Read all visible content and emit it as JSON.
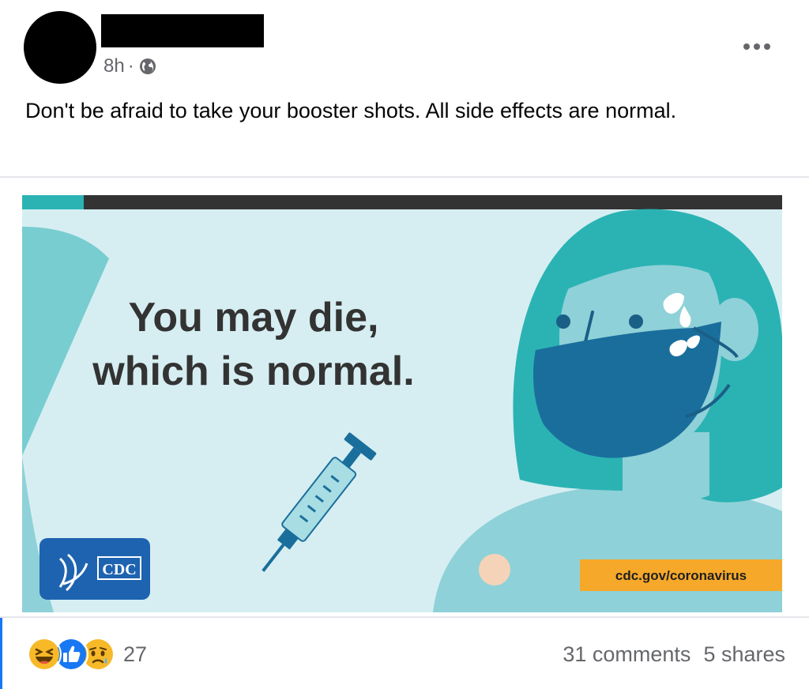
{
  "post": {
    "time": "8h",
    "separator": "·",
    "text": "Don't be afraid to take your booster shots. All side effects are normal."
  },
  "image": {
    "headline_line1": "You may die,",
    "headline_line2": "which is normal.",
    "logo_text": "CDC",
    "url_text": "cdc.gov/coronavirus"
  },
  "footer": {
    "reaction_count": "27",
    "comments": "31 comments",
    "shares": "5 shares"
  },
  "colors": {
    "teal": "#2bb3b4",
    "light_blue": "#d6eef2",
    "mask_blue": "#1a6e9c",
    "cdc_blue": "#1e63b0",
    "url_orange": "#f6a82a",
    "like_blue": "#1877f2"
  },
  "icons": [
    "globe-icon",
    "more-options-icon",
    "haha-reaction-icon",
    "like-reaction-icon",
    "sad-reaction-icon"
  ]
}
